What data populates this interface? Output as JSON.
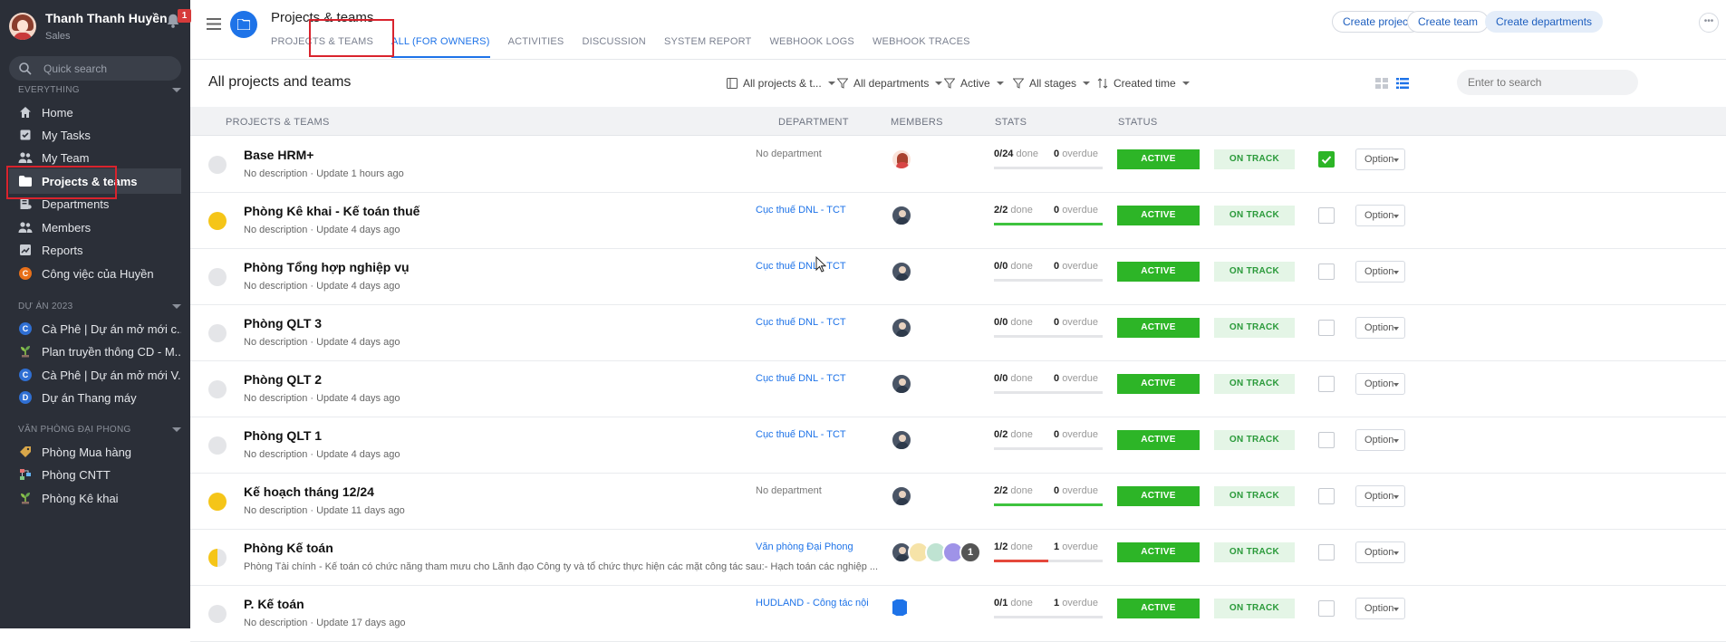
{
  "user": {
    "name": "Thanh Thanh Huyền",
    "role": "Sales",
    "notification_count": "1"
  },
  "sidebar": {
    "search_placeholder": "Quick search",
    "section_everything": "EVERYTHING",
    "items": [
      {
        "label": "Home",
        "icon": "home-icon"
      },
      {
        "label": "My Tasks",
        "icon": "tasks-icon"
      },
      {
        "label": "My Team",
        "icon": "team-icon"
      },
      {
        "label": "Projects & teams",
        "icon": "folder-icon",
        "active": true
      },
      {
        "label": "Departments",
        "icon": "departments-icon"
      },
      {
        "label": "Members",
        "icon": "members-icon"
      },
      {
        "label": "Reports",
        "icon": "reports-icon"
      },
      {
        "label": "Công việc của Huyền",
        "icon": "C"
      }
    ],
    "section_project": "DỰ ÁN 2023",
    "project_items": [
      {
        "label": "Cà Phê | Dự án mở mới c...",
        "icon": "C"
      },
      {
        "label": "Plan truyền thông CD - M...",
        "icon": "plant-icon"
      },
      {
        "label": "Cà Phê | Dự án mở mới V...",
        "icon": "C"
      },
      {
        "label": "Dự án Thang máy",
        "icon": "D"
      }
    ],
    "section_office": "VĂN PHÒNG ĐẠI PHONG",
    "office_items": [
      {
        "label": "Phòng Mua hàng",
        "icon": "tag-icon"
      },
      {
        "label": "Phòng CNTT",
        "icon": "network-icon"
      },
      {
        "label": "Phòng Kê khai",
        "icon": "plant-icon"
      }
    ]
  },
  "header": {
    "title": "Projects & teams",
    "tabs": [
      "PROJECTS & TEAMS",
      "ALL (FOR OWNERS)",
      "ACTIVITIES",
      "DISCUSSION",
      "SYSTEM REPORT",
      "WEBHOOK LOGS",
      "WEBHOOK TRACES"
    ],
    "active_tab": "ALL (FOR OWNERS)",
    "buttons": {
      "create_project": "Create project",
      "create_team": "Create team",
      "create_departments": "Create departments"
    }
  },
  "toolbar": {
    "heading": "All projects and teams",
    "filters": {
      "scope": "All projects & t...",
      "departments": "All departments",
      "status": "Active",
      "stages": "All stages",
      "sort": "Created time"
    },
    "search_placeholder": "Enter to search"
  },
  "table": {
    "columns": {
      "name": "PROJECTS & TEAMS",
      "department": "DEPARTMENT",
      "members": "MEMBERS",
      "stats": "STATS",
      "status": "STATUS"
    },
    "done_word": "done",
    "overdue_word": "overdue",
    "rows": [
      {
        "name": "Base HRM+",
        "desc": "No description · Update 1 hours ago",
        "dept": "No department",
        "dept_link": false,
        "dot": "grey",
        "done": "0",
        "total": "24",
        "overdue": "0",
        "progress": 0,
        "status": "ACTIVE",
        "track": "ON TRACK",
        "checked": true,
        "option": "Option"
      },
      {
        "name": "Phòng Kê khai - Kế toán thuế",
        "desc": "No description · Update 4 days ago",
        "dept": "Cục thuế DNL - TCT",
        "dept_link": true,
        "dot": "yellow",
        "done": "2",
        "total": "2",
        "overdue": "0",
        "progress": 1,
        "status": "ACTIVE",
        "track": "ON TRACK",
        "checked": false,
        "option": "Option"
      },
      {
        "name": "Phòng Tổng hợp nghiệp vụ",
        "desc": "No description · Update 4 days ago",
        "dept": "Cục thuế DNL - TCT",
        "dept_link": true,
        "dot": "grey",
        "done": "0",
        "total": "0",
        "overdue": "0",
        "progress": 0,
        "status": "ACTIVE",
        "track": "ON TRACK",
        "checked": false,
        "option": "Option"
      },
      {
        "name": "Phòng QLT 3",
        "desc": "No description · Update 4 days ago",
        "dept": "Cục thuế DNL - TCT",
        "dept_link": true,
        "dot": "grey",
        "done": "0",
        "total": "0",
        "overdue": "0",
        "progress": 0,
        "status": "ACTIVE",
        "track": "ON TRACK",
        "checked": false,
        "option": "Option"
      },
      {
        "name": "Phòng QLT 2",
        "desc": "No description · Update 4 days ago",
        "dept": "Cục thuế DNL - TCT",
        "dept_link": true,
        "dot": "grey",
        "done": "0",
        "total": "0",
        "overdue": "0",
        "progress": 0,
        "status": "ACTIVE",
        "track": "ON TRACK",
        "checked": false,
        "option": "Option"
      },
      {
        "name": "Phòng QLT 1",
        "desc": "No description · Update 4 days ago",
        "dept": "Cục thuế DNL - TCT",
        "dept_link": true,
        "dot": "grey",
        "done": "0",
        "total": "2",
        "overdue": "0",
        "progress": 0,
        "status": "ACTIVE",
        "track": "ON TRACK",
        "checked": false,
        "option": "Option"
      },
      {
        "name": "Kế hoạch tháng 12/24",
        "desc": "No description · Update 11 days ago",
        "dept": "No department",
        "dept_link": false,
        "dot": "yellow",
        "done": "2",
        "total": "2",
        "overdue": "0",
        "progress": 1,
        "status": "ACTIVE",
        "track": "ON TRACK",
        "checked": false,
        "option": "Option"
      },
      {
        "name": "Phòng Kế toán",
        "desc": "Phòng Tài chính - Kế toán có chức năng tham mưu cho Lãnh đạo Công ty và tổ chức thực hiện các mặt công tác sau:- Hạch toán các nghiệp ...",
        "dept": "Văn phòng Đại Phong",
        "dept_link": true,
        "dot": "half",
        "done": "1",
        "total": "2",
        "overdue": "1",
        "progress": 0.5,
        "progress_red": true,
        "status": "ACTIVE",
        "track": "ON TRACK",
        "checked": false,
        "option": "Option",
        "multi_members": true,
        "extra_members": "1"
      },
      {
        "name": "P. Kế toán",
        "desc": "No description · Update 17 days ago",
        "dept": "HUDLAND - Công tác nội",
        "dept_link": true,
        "dot": "grey",
        "done": "0",
        "total": "1",
        "overdue": "1",
        "progress": 0,
        "status": "ACTIVE",
        "track": "ON TRACK",
        "checked": false,
        "option": "Option",
        "hud_member": true
      }
    ]
  }
}
